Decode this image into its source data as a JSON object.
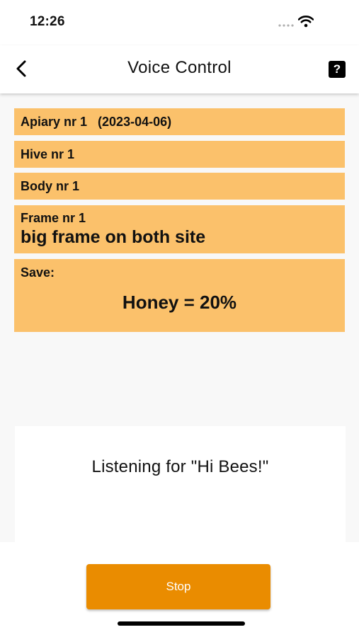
{
  "status_bar": {
    "time": "12:26",
    "signal_icon": "signal-dots-icon",
    "wifi_icon": "wifi-icon"
  },
  "nav": {
    "title": "Voice Control",
    "back_icon": "chevron-left-icon",
    "help_icon": "question-mark-icon",
    "help_glyph": "?"
  },
  "cards": {
    "apiary": "Apiary nr 1   (2023-04-06)",
    "hive": "Hive nr 1",
    "body": "Body nr 1",
    "frame_label": "Frame nr 1",
    "frame_desc": "big frame on both site",
    "save_label": "Save:",
    "save_value": "Honey = 20%"
  },
  "listening": {
    "text": "Listening for \"Hi Bees!\""
  },
  "actions": {
    "stop_label": "Stop"
  },
  "colors": {
    "card_background": "#fbc16b",
    "accent": "#ea8c00",
    "page_background": "#f8f8f8"
  }
}
